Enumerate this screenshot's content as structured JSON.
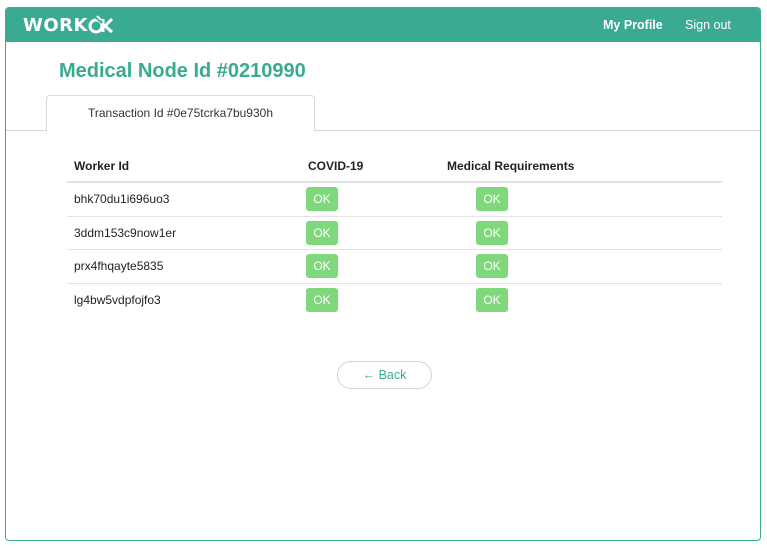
{
  "brand": {
    "logo_text": "WORK",
    "logo_mark_text": "OK",
    "color": "#3aaa93"
  },
  "nav": {
    "my_profile": "My Profile",
    "sign_out": "Sign out"
  },
  "page": {
    "title": "Medical Node Id #0210990"
  },
  "tabs": [
    {
      "label": "Transaction Id #0e75tcrka7bu930h",
      "active": true
    }
  ],
  "table": {
    "headers": {
      "worker_id": "Worker Id",
      "covid": "COVID-19",
      "medical": "Medical Requirements"
    },
    "rows": [
      {
        "worker_id": "bhk70du1i696uo3",
        "covid": "OK",
        "medical": "OK"
      },
      {
        "worker_id": "3ddm153c9now1er",
        "covid": "OK",
        "medical": "OK"
      },
      {
        "worker_id": "prx4fhqayte5835",
        "covid": "OK",
        "medical": "OK"
      },
      {
        "worker_id": "lg4bw5vdpfojfo3",
        "covid": "OK",
        "medical": "OK"
      }
    ],
    "status_color": "#7fd87b"
  },
  "back_button": {
    "label": "← Back"
  }
}
